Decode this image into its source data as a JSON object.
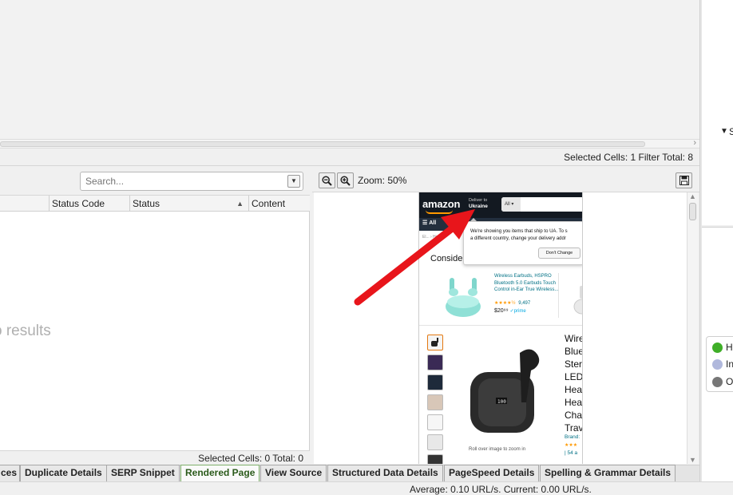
{
  "top_status": {
    "text": "Selected Cells:  1  Filter Total:  8"
  },
  "tree": {
    "label": "S"
  },
  "legend": [
    {
      "label": "H",
      "color": "#3fae28"
    },
    {
      "label": "In",
      "color": "#b0b8dc"
    },
    {
      "label": "O",
      "color": "#777777"
    }
  ],
  "left_pane": {
    "search_placeholder": "Search...",
    "columns": [
      "Status Code",
      "Status",
      "Content"
    ],
    "empty_text": "o results",
    "footer": "Selected Cells:  0  Total:  0"
  },
  "rendered": {
    "zoom_label": "Zoom: 50%",
    "amazon": {
      "logo": "amazon",
      "deliver_line1": "Deliver to",
      "deliver_line2": "Ukraine",
      "search_cat": "All",
      "nav_all": "All",
      "popover_line1": "We're showing you items that ship to UA. To s",
      "popover_line2": "a different country, change your delivery addr",
      "popover_button": "Don't Change",
      "breadcrumb": "El...  › Hea...",
      "consider": "Conside",
      "sponsored_title": "Wireless Earbuds, HSPRO Bluetooth 5.0 Earbuds Touch Control in-Ear True Wireless...",
      "sponsored_rating": "★★★★½",
      "sponsored_reviews": "9,497",
      "sponsored_price": "$20⁹⁹",
      "sponsored_prime": "✓prime",
      "title_lines": [
        "Wire",
        "Blue",
        "Ster",
        "LED",
        "Hea",
        "Hea",
        "Cha",
        "Trav"
      ],
      "brand": "Brand:",
      "stars": "★★★",
      "reviews_frag": "| 54 a",
      "roll_over": "Roll over image to zoom in"
    }
  },
  "tabs": [
    {
      "label": "ces",
      "active": false
    },
    {
      "label": "Duplicate Details",
      "active": false
    },
    {
      "label": "SERP Snippet",
      "active": false
    },
    {
      "label": "Rendered Page",
      "active": true
    },
    {
      "label": "View Source",
      "active": false
    },
    {
      "label": "Structured Data Details",
      "active": false
    },
    {
      "label": "PageSpeed Details",
      "active": false
    },
    {
      "label": "Spelling & Grammar Details",
      "active": false
    }
  ],
  "bottom_status": {
    "text": "Average: 0.10 URL/s. Current: 0.00 URL/s."
  },
  "icons": [
    "zoom-out-icon",
    "zoom-in-icon",
    "save-icon",
    "chevron-down-icon",
    "sort-up-icon"
  ]
}
